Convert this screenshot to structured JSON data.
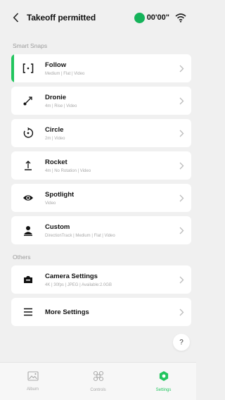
{
  "header": {
    "title": "Takeoff permitted",
    "timer": "00'00\""
  },
  "sections": {
    "smart_snaps": "Smart Snaps",
    "others": "Others"
  },
  "snaps": [
    {
      "name": "Follow",
      "sub": "Medium | Flat | Video",
      "icon": "follow-icon",
      "selected": true
    },
    {
      "name": "Dronie",
      "sub": "4m | Rise | Video",
      "icon": "dronie-icon"
    },
    {
      "name": "Circle",
      "sub": "2m | Video",
      "icon": "circle-icon"
    },
    {
      "name": "Rocket",
      "sub": "4m | No Rotation | Video",
      "icon": "rocket-icon"
    },
    {
      "name": "Spotlight",
      "sub": "Video",
      "icon": "eye-icon"
    },
    {
      "name": "Custom",
      "sub": "DirectionTrack | Medium | Flat | Video",
      "icon": "person-icon"
    }
  ],
  "others": [
    {
      "name": "Camera Settings",
      "sub": "4K | 30fps | JPEG | Available:2.0GB",
      "icon": "camera-icon"
    },
    {
      "name": "More Settings",
      "sub": "",
      "icon": "menu-icon"
    }
  ],
  "help": "?",
  "tabs": [
    {
      "label": "Album",
      "icon": "album-icon"
    },
    {
      "label": "Controls",
      "icon": "controls-icon"
    },
    {
      "label": "Settings",
      "icon": "settings-icon",
      "active": true
    }
  ],
  "colors": {
    "accent": "#22c55e",
    "timer_dot": "#15b35a",
    "background": "#f0f0f0"
  }
}
